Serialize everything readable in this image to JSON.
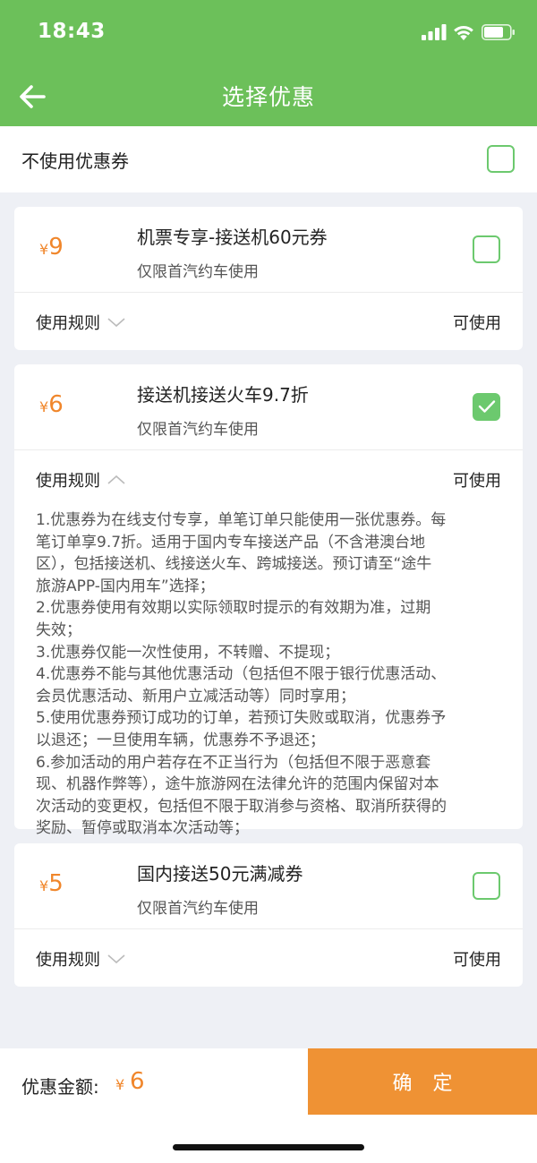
{
  "status": {
    "time": "18:43"
  },
  "header": {
    "title": "选择优惠"
  },
  "no_coupon": {
    "label": "不使用优惠券",
    "checked": false
  },
  "coupons": [
    {
      "currency": "¥",
      "amount": "9",
      "title": "机票专享-接送机60元券",
      "desc": "仅限首汽约车使用",
      "rules_label": "使用规则",
      "status": "可使用",
      "checked": false,
      "expanded": false
    },
    {
      "currency": "¥",
      "amount": "6",
      "title": "接送机接送火车9.7折",
      "desc": "仅限首汽约车使用",
      "rules_label": "使用规则",
      "status": "可使用",
      "checked": true,
      "expanded": true,
      "rules": [
        "1.优惠券为在线支付专享，单笔订单只能使用一张优惠券。每",
        "笔订单享9.7折。适用于国内专车接送产品（不含港澳台地",
        "区），包括接送机、线接送火车、跨城接送。预订请至“途牛",
        "旅游APP-国内用车”选择；",
        "2.优惠券使用有效期以实际领取时提示的有效期为准，过期",
        "失效；",
        "3.优惠券仅能一次性使用，不转赠、不提现；",
        "4.优惠券不能与其他优惠活动（包括但不限于银行优惠活动、",
        "会员优惠活动、新用户立减活动等）同时享用；",
        "5.使用优惠券预订成功的订单，若预订失败或取消，优惠券予",
        "以退还；一旦使用车辆，优惠券不予退还；",
        "6.参加活动的用户若存在不正当行为（包括但不限于恶意套",
        "现、机器作弊等），途牛旅游网在法律允许的范围内保留对本",
        "次活动的变更权，包括但不限于取消参与资格、取消所获得的",
        "奖励、暂停或取消本次活动等；"
      ]
    },
    {
      "currency": "¥",
      "amount": "5",
      "title": "国内接送50元满减券",
      "desc": "仅限首汽约车使用",
      "rules_label": "使用规则",
      "status": "可使用",
      "checked": false,
      "expanded": false
    }
  ],
  "footer": {
    "total_label": "优惠金额:",
    "total_currency": "¥",
    "total_amount": "6",
    "confirm_label": "确 定"
  },
  "colors": {
    "header_green": "#6cc05a",
    "check_green": "#6cc96e",
    "price_orange": "#f0862b",
    "confirm_orange": "#ef9234"
  }
}
